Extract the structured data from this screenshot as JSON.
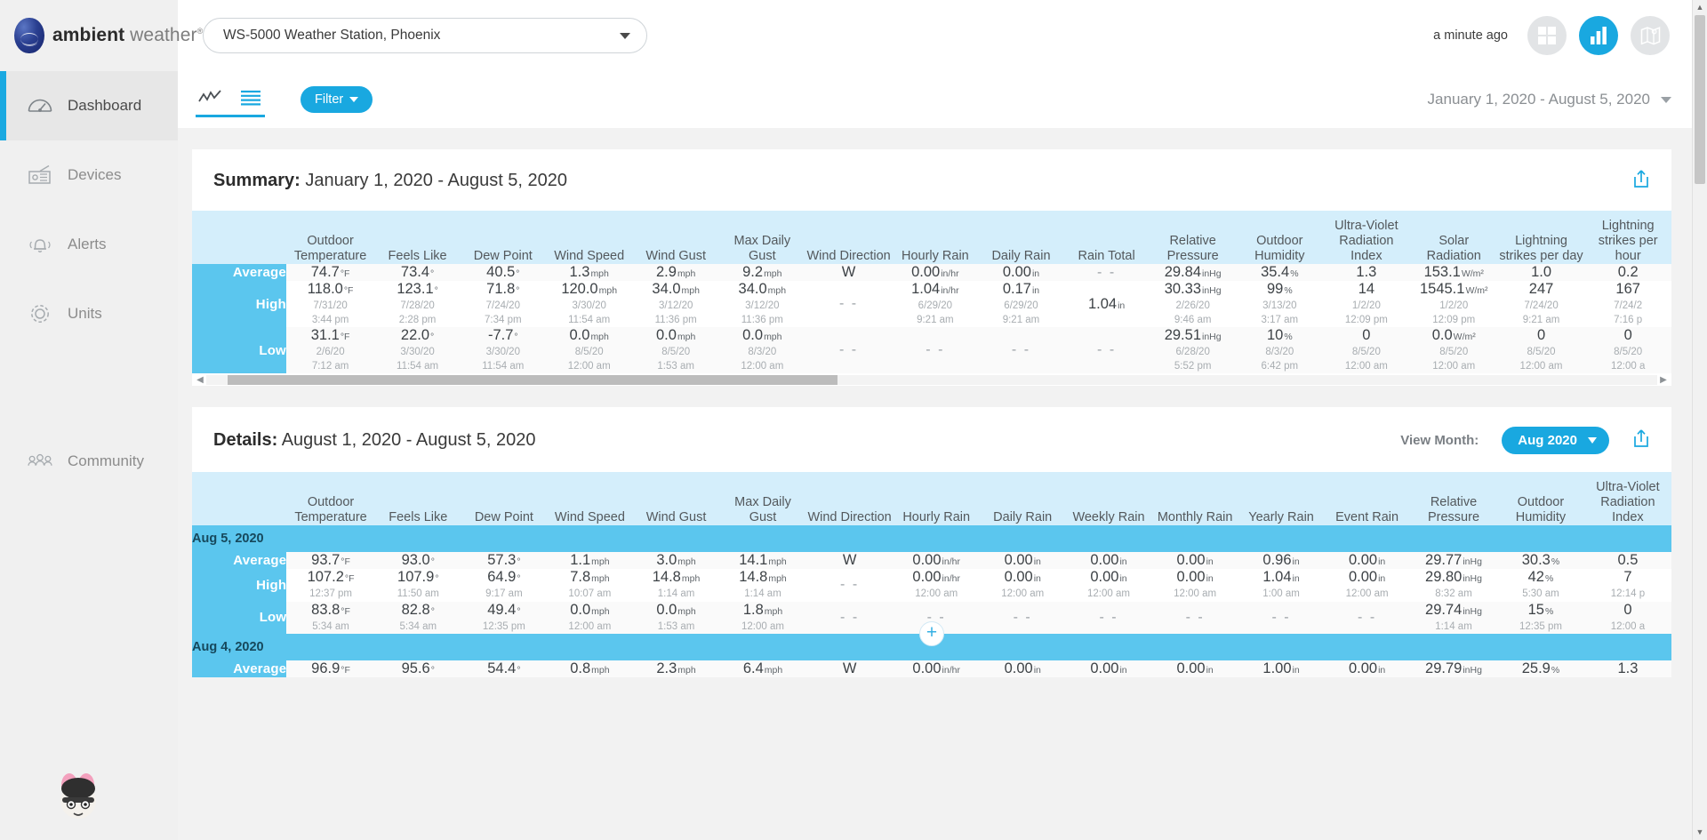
{
  "brand": {
    "name_bold": "ambient",
    "name_light": " weather",
    "registered": "®"
  },
  "header": {
    "station_select_value": "WS-5000 Weather Station, Phoenix",
    "updated_ago": "a minute ago",
    "icons": [
      "grid-view-icon",
      "chart-view-icon",
      "map-view-icon"
    ]
  },
  "sidebar": {
    "items": [
      {
        "label": "Dashboard",
        "icon": "gauge-icon",
        "active": true
      },
      {
        "label": "Devices",
        "icon": "device-icon",
        "active": false
      },
      {
        "label": "Alerts",
        "icon": "bell-icon",
        "active": false
      },
      {
        "label": "Units",
        "icon": "gear-icon",
        "active": false
      },
      {
        "label": "Community",
        "icon": "people-icon",
        "active": false
      }
    ]
  },
  "toolbar": {
    "filter_label": "Filter",
    "date_range": "January 1, 2020 - August 5, 2020",
    "graph_toggle_icon": "line-graph-icon",
    "table_toggle_icon": "list-table-icon"
  },
  "summary": {
    "title_bold": "Summary:",
    "title_range": "January 1, 2020 - August 5, 2020",
    "share_icon": "share-upload-icon",
    "columns": [
      "Outdoor Temperature",
      "Feels Like",
      "Dew Point",
      "Wind Speed",
      "Wind Gust",
      "Max Daily Gust",
      "Wind Direction",
      "Hourly Rain",
      "Daily Rain",
      "Rain Total",
      "Relative Pressure",
      "Outdoor Humidity",
      "Ultra-Violet Radiation Index",
      "Solar Radiation",
      "Lightning strikes per day",
      "Lightning strikes per hour"
    ],
    "rows": [
      {
        "label": "Average",
        "cells": [
          {
            "value": "74.7",
            "unit": "°F"
          },
          {
            "value": "73.4",
            "unit": "°"
          },
          {
            "value": "40.5",
            "unit": "°"
          },
          {
            "value": "1.3",
            "unit": "mph"
          },
          {
            "value": "2.9",
            "unit": "mph"
          },
          {
            "value": "9.2",
            "unit": "mph"
          },
          {
            "value": "W",
            "unit": ""
          },
          {
            "value": "0.00",
            "unit": "in/hr"
          },
          {
            "value": "0.00",
            "unit": "in"
          },
          {
            "value": "--",
            "unit": ""
          },
          {
            "value": "29.84",
            "unit": "inHg"
          },
          {
            "value": "35.4",
            "unit": "%"
          },
          {
            "value": "1.3",
            "unit": ""
          },
          {
            "value": "153.1",
            "unit": "W/m²"
          },
          {
            "value": "1.0",
            "unit": ""
          },
          {
            "value": "0.2",
            "unit": ""
          }
        ]
      },
      {
        "label": "High",
        "cells": [
          {
            "value": "118.0",
            "unit": "°F",
            "date": "7/31/20",
            "time": "3:44 pm"
          },
          {
            "value": "123.1",
            "unit": "°",
            "date": "7/28/20",
            "time": "2:28 pm"
          },
          {
            "value": "71.8",
            "unit": "°",
            "date": "7/24/20",
            "time": "7:34 pm"
          },
          {
            "value": "120.0",
            "unit": "mph",
            "date": "3/30/20",
            "time": "11:54 am"
          },
          {
            "value": "34.0",
            "unit": "mph",
            "date": "3/12/20",
            "time": "11:36 pm"
          },
          {
            "value": "34.0",
            "unit": "mph",
            "date": "3/12/20",
            "time": "11:36 pm"
          },
          {
            "value": "--",
            "unit": ""
          },
          {
            "value": "1.04",
            "unit": "in/hr",
            "date": "6/29/20",
            "time": "9:21 am"
          },
          {
            "value": "0.17",
            "unit": "in",
            "date": "6/29/20",
            "time": "9:21 am"
          },
          {
            "value": "1.04",
            "unit": "in"
          },
          {
            "value": "30.33",
            "unit": "inHg",
            "date": "2/26/20",
            "time": "9:46 am"
          },
          {
            "value": "99",
            "unit": "%",
            "date": "3/13/20",
            "time": "3:17 am"
          },
          {
            "value": "14",
            "unit": "",
            "date": "1/2/20",
            "time": "12:09 pm"
          },
          {
            "value": "1545.1",
            "unit": "W/m²",
            "date": "1/2/20",
            "time": "12:09 pm"
          },
          {
            "value": "247",
            "unit": "",
            "date": "7/24/20",
            "time": "9:21 am"
          },
          {
            "value": "167",
            "unit": "",
            "date": "7/24/2",
            "time": "7:16 p"
          }
        ]
      },
      {
        "label": "Low",
        "cells": [
          {
            "value": "31.1",
            "unit": "°F",
            "date": "2/6/20",
            "time": "7:12 am"
          },
          {
            "value": "22.0",
            "unit": "°",
            "date": "3/30/20",
            "time": "11:54 am"
          },
          {
            "value": "-7.7",
            "unit": "°",
            "date": "3/30/20",
            "time": "11:54 am"
          },
          {
            "value": "0.0",
            "unit": "mph",
            "date": "8/5/20",
            "time": "12:00 am"
          },
          {
            "value": "0.0",
            "unit": "mph",
            "date": "8/5/20",
            "time": "1:53 am"
          },
          {
            "value": "0.0",
            "unit": "mph",
            "date": "8/3/20",
            "time": "12:00 am"
          },
          {
            "value": "--",
            "unit": ""
          },
          {
            "value": "--",
            "unit": ""
          },
          {
            "value": "--",
            "unit": ""
          },
          {
            "value": "--",
            "unit": ""
          },
          {
            "value": "29.51",
            "unit": "inHg",
            "date": "6/28/20",
            "time": "5:52 pm"
          },
          {
            "value": "10",
            "unit": "%",
            "date": "8/3/20",
            "time": "6:42 pm"
          },
          {
            "value": "0",
            "unit": "",
            "date": "8/5/20",
            "time": "12:00 am"
          },
          {
            "value": "0.0",
            "unit": "W/m²",
            "date": "8/5/20",
            "time": "12:00 am"
          },
          {
            "value": "0",
            "unit": "",
            "date": "8/5/20",
            "time": "12:00 am"
          },
          {
            "value": "0",
            "unit": "",
            "date": "8/5/20",
            "time": "12:00 a"
          }
        ]
      }
    ],
    "scrollbar": {
      "left_arrow": "◀",
      "right_arrow": "▶"
    }
  },
  "details": {
    "title_bold": "Details:",
    "title_range": "August 1, 2020 - August 5, 2020",
    "view_month_label": "View Month:",
    "month_value": "Aug 2020",
    "share_icon": "share-upload-icon",
    "columns": [
      "Outdoor Temperature",
      "Feels Like",
      "Dew Point",
      "Wind Speed",
      "Wind Gust",
      "Max Daily Gust",
      "Wind Direction",
      "Hourly Rain",
      "Daily Rain",
      "Weekly Rain",
      "Monthly Rain",
      "Yearly Rain",
      "Event Rain",
      "Relative Pressure",
      "Outdoor Humidity",
      "Ultra-Violet Radiation Index"
    ],
    "groups": [
      {
        "day": "Aug 5, 2020",
        "rows": [
          {
            "label": "Average",
            "cells": [
              {
                "value": "93.7",
                "unit": "°F"
              },
              {
                "value": "93.0",
                "unit": "°"
              },
              {
                "value": "57.3",
                "unit": "°"
              },
              {
                "value": "1.1",
                "unit": "mph"
              },
              {
                "value": "3.0",
                "unit": "mph"
              },
              {
                "value": "14.1",
                "unit": "mph"
              },
              {
                "value": "W",
                "unit": ""
              },
              {
                "value": "0.00",
                "unit": "in/hr"
              },
              {
                "value": "0.00",
                "unit": "in"
              },
              {
                "value": "0.00",
                "unit": "in"
              },
              {
                "value": "0.00",
                "unit": "in"
              },
              {
                "value": "0.96",
                "unit": "in"
              },
              {
                "value": "0.00",
                "unit": "in"
              },
              {
                "value": "29.77",
                "unit": "inHg"
              },
              {
                "value": "30.3",
                "unit": "%"
              },
              {
                "value": "0.5",
                "unit": ""
              }
            ]
          },
          {
            "label": "High",
            "cells": [
              {
                "value": "107.2",
                "unit": "°F",
                "time": "12:37 pm"
              },
              {
                "value": "107.9",
                "unit": "°",
                "time": "11:50 am"
              },
              {
                "value": "64.9",
                "unit": "°",
                "time": "9:17 am"
              },
              {
                "value": "7.8",
                "unit": "mph",
                "time": "10:07 am"
              },
              {
                "value": "14.8",
                "unit": "mph",
                "time": "1:14 am"
              },
              {
                "value": "14.8",
                "unit": "mph",
                "time": "1:14 am"
              },
              {
                "value": "--",
                "unit": ""
              },
              {
                "value": "0.00",
                "unit": "in/hr",
                "time": "12:00 am"
              },
              {
                "value": "0.00",
                "unit": "in",
                "time": "12:00 am"
              },
              {
                "value": "0.00",
                "unit": "in",
                "time": "12:00 am"
              },
              {
                "value": "0.00",
                "unit": "in",
                "time": "12:00 am"
              },
              {
                "value": "1.04",
                "unit": "in",
                "time": "1:00 am"
              },
              {
                "value": "0.00",
                "unit": "in",
                "time": "12:00 am"
              },
              {
                "value": "29.80",
                "unit": "inHg",
                "time": "8:32 am"
              },
              {
                "value": "42",
                "unit": "%",
                "time": "5:30 am"
              },
              {
                "value": "7",
                "unit": "",
                "time": "12:14 p"
              }
            ]
          },
          {
            "label": "Low",
            "cells": [
              {
                "value": "83.8",
                "unit": "°F",
                "time": "5:34 am"
              },
              {
                "value": "82.8",
                "unit": "°",
                "time": "5:34 am"
              },
              {
                "value": "49.4",
                "unit": "°",
                "time": "12:35 pm"
              },
              {
                "value": "0.0",
                "unit": "mph",
                "time": "12:00 am"
              },
              {
                "value": "0.0",
                "unit": "mph",
                "time": "1:53 am"
              },
              {
                "value": "1.8",
                "unit": "mph",
                "time": "12:00 am"
              },
              {
                "value": "--",
                "unit": ""
              },
              {
                "value": "--",
                "unit": ""
              },
              {
                "value": "--",
                "unit": ""
              },
              {
                "value": "--",
                "unit": ""
              },
              {
                "value": "--",
                "unit": ""
              },
              {
                "value": "--",
                "unit": ""
              },
              {
                "value": "--",
                "unit": ""
              },
              {
                "value": "29.74",
                "unit": "inHg",
                "time": "1:14 am"
              },
              {
                "value": "15",
                "unit": "%",
                "time": "12:35 pm"
              },
              {
                "value": "0",
                "unit": "",
                "time": "12:00 a"
              }
            ]
          }
        ]
      },
      {
        "day": "Aug 4, 2020",
        "rows": [
          {
            "label": "Average",
            "cells": [
              {
                "value": "96.9",
                "unit": "°F"
              },
              {
                "value": "95.6",
                "unit": "°"
              },
              {
                "value": "54.4",
                "unit": "°"
              },
              {
                "value": "0.8",
                "unit": "mph"
              },
              {
                "value": "2.3",
                "unit": "mph"
              },
              {
                "value": "6.4",
                "unit": "mph"
              },
              {
                "value": "W",
                "unit": ""
              },
              {
                "value": "0.00",
                "unit": "in/hr"
              },
              {
                "value": "0.00",
                "unit": "in"
              },
              {
                "value": "0.00",
                "unit": "in"
              },
              {
                "value": "0.00",
                "unit": "in"
              },
              {
                "value": "1.00",
                "unit": "in"
              },
              {
                "value": "0.00",
                "unit": "in"
              },
              {
                "value": "29.79",
                "unit": "inHg"
              },
              {
                "value": "25.9",
                "unit": "%"
              },
              {
                "value": "1.3",
                "unit": ""
              }
            ]
          }
        ]
      }
    ],
    "expand_icon": "plus-circle-icon"
  },
  "colors": {
    "accent": "#19a8e0",
    "row_label_bg": "#5bc6ee",
    "table_header_bg": "#d4eefb",
    "sidebar_bg": "#f0f0f0"
  }
}
